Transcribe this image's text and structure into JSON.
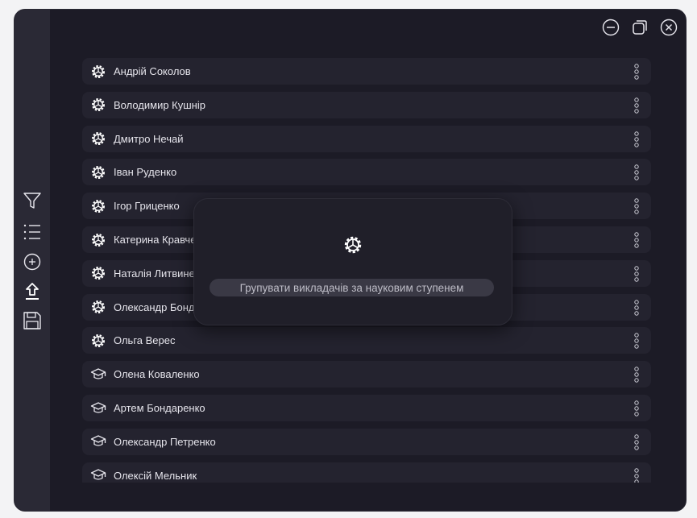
{
  "window_controls": [
    "minimize",
    "restore",
    "close"
  ],
  "sidebar": {
    "items": [
      {
        "name": "filter-icon"
      },
      {
        "name": "list-icon"
      },
      {
        "name": "add-circle-icon"
      },
      {
        "name": "upload-icon"
      },
      {
        "name": "save-icon"
      }
    ]
  },
  "teachers": [
    {
      "name": "Андрій Соколов",
      "icon": "gear-icon"
    },
    {
      "name": "Володимир Кушнір",
      "icon": "gear-icon"
    },
    {
      "name": "Дмитро Нечай",
      "icon": "gear-icon"
    },
    {
      "name": "Іван Руденко",
      "icon": "gear-icon"
    },
    {
      "name": "Ігор Гриценко",
      "icon": "gear-icon"
    },
    {
      "name": "Катерина Кравченко",
      "icon": "gear-icon"
    },
    {
      "name": "Наталія Литвиненко",
      "icon": "gear-icon"
    },
    {
      "name": "Олександр Бондар",
      "icon": "gear-icon"
    },
    {
      "name": "Ольга Верес",
      "icon": "gear-icon"
    },
    {
      "name": "Олена Коваленко",
      "icon": "graduation-cap-icon"
    },
    {
      "name": "Артем Бондаренко",
      "icon": "graduation-cap-icon"
    },
    {
      "name": "Олександр Петренко",
      "icon": "graduation-cap-icon"
    },
    {
      "name": "Олексій Мельник",
      "icon": "graduation-cap-icon"
    }
  ],
  "popup": {
    "icon": "gear-icon",
    "action_label": "Групувати викладачів за науковим ступенем"
  },
  "colors": {
    "background": "#1c1b26",
    "sidebar": "#2a2935",
    "row": "#24232f",
    "text": "#e6e5ec"
  }
}
